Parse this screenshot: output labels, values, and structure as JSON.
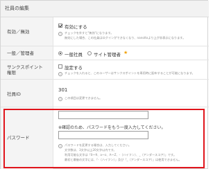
{
  "panel": {
    "title": "社員の編集"
  },
  "rows": {
    "enable": {
      "label": "有効／無効",
      "checkbox_label": "有効にする",
      "help_line1": "チェックを外すと\"無効\"になります。",
      "help_line2": "無効にした場合、この社員はログインができなくなり、nanoltoより上が非表示になります。"
    },
    "role": {
      "label": "一般／管理者",
      "option_general": "一般社員",
      "option_admin": "サイト管理者",
      "selected": "一般社員"
    },
    "thanks_points": {
      "label_line1": "サンクスポイント",
      "label_line2": "権限",
      "checkbox_label": "設定する",
      "help": "チェックを入れると、このユーザーはサンクスポイントを専用時に配布することが可能になります。"
    },
    "employee_id": {
      "label": "社員ID",
      "value": "301",
      "help": "この項目は変更できません。"
    },
    "password": {
      "label": "パスワード",
      "input_value": "",
      "confirm_note": "※確認のため、パスワードをもう一度入力してください。",
      "confirm_value": "",
      "help_line1": "パスワードを変更する場合は、入力してください。",
      "help_line2": "文字数は、3文字以上20文字以内です。",
      "help_line3": "利用可能な文字は「0～9、a～z、A～Z、-（ハイフン）、_（アンダースコア）」です。",
      "help_line4": "最初と最後の文字には、「-（ハイフン）」及び「_（アンダースコア）」は使用できません。"
    }
  },
  "colors": {
    "highlight_border": "#e0141b",
    "label_bg": "#f4f4f4",
    "admin_star": "#f0a000"
  }
}
